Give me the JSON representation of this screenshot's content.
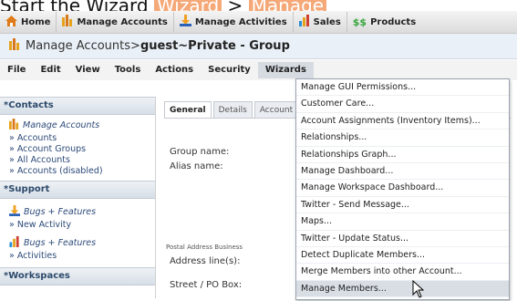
{
  "caption": {
    "prefix": "Start the Wizard ",
    "wizard_word": "Wizard",
    "arrow": " > ",
    "target": "Manage"
  },
  "nav": {
    "tabs": [
      {
        "label": "Home",
        "icon": "home-icon"
      },
      {
        "label": "Manage Accounts",
        "icon": "accounts-icon"
      },
      {
        "label": "Manage Activities",
        "icon": "activities-icon"
      },
      {
        "label": "Sales",
        "icon": "sales-icon"
      },
      {
        "label": "Products",
        "icon": "products-icon"
      }
    ]
  },
  "title": {
    "section": "Manage Accounts",
    "separator": " > ",
    "record": "guest~Private - Group"
  },
  "menubar": {
    "items": [
      "File",
      "Edit",
      "View",
      "Tools",
      "Actions",
      "Security",
      "Wizards"
    ],
    "active": "Wizards"
  },
  "sidebar": {
    "contacts": {
      "header": "*Contacts",
      "group": "Manage Accounts",
      "links": [
        "» Accounts",
        "» Account Groups",
        "» All Accounts",
        "» Accounts (disabled)"
      ]
    },
    "support": {
      "header": "*Support",
      "group1": "Bugs + Features",
      "links1": [
        "» New Activity"
      ],
      "group2": "Bugs + Features",
      "links2": [
        "» Activities"
      ]
    },
    "workspaces": {
      "header": "*Workspaces"
    }
  },
  "main": {
    "tabs": [
      "General",
      "Details",
      "Account"
    ],
    "group_name_label": "Group name:",
    "alias_name_label": "Alias name:",
    "postal_label": "Postal Address Business",
    "address_label": "Address line(s):",
    "street_label": "Street / PO Box:"
  },
  "wizards_menu": {
    "items": [
      "Manage GUI Permissions...",
      "Customer Care...",
      "Account Assignments (Inventory Items)...",
      "Relationships...",
      "Relationships Graph...",
      "Manage Dashboard...",
      "Manage Workspace Dashboard...",
      "Twitter - Send Message...",
      "Maps...",
      "Twitter - Update Status...",
      "Detect Duplicate Members...",
      "Merge Members into other Account...",
      "Manage Members..."
    ],
    "hovered_index": 12
  }
}
